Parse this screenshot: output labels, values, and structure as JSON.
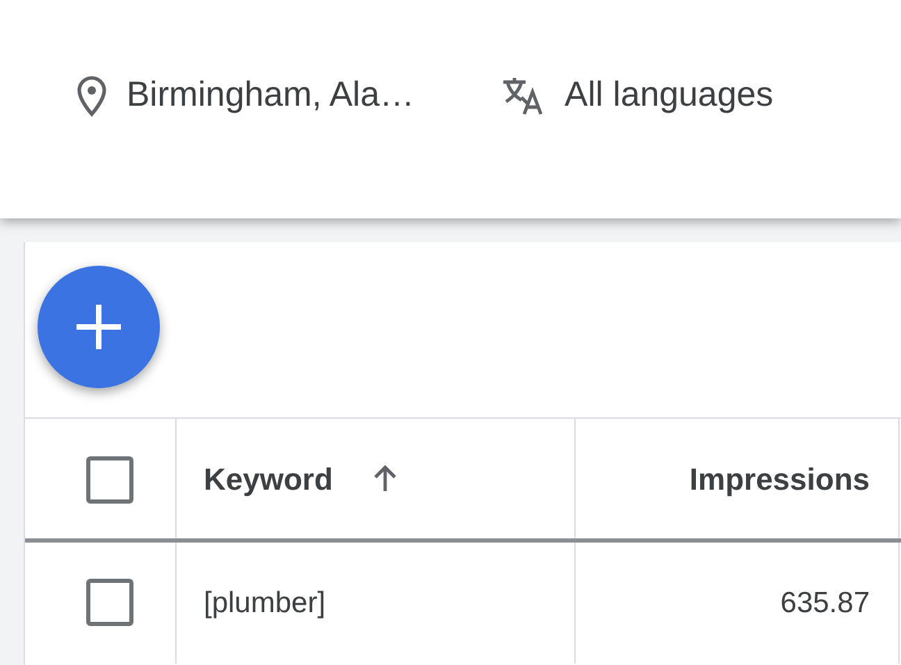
{
  "filters": [
    {
      "kind": "location",
      "label": "Birmingham, Ala…"
    },
    {
      "kind": "language",
      "label": "All languages"
    }
  ],
  "table": {
    "header_checked": false,
    "columns": [
      {
        "label": "Keyword",
        "sorted": true,
        "kind": "text"
      },
      {
        "label": "Impressions",
        "sorted": false,
        "kind": "number"
      }
    ],
    "rows": [
      {
        "checked": false,
        "cells": [
          "[plumber]",
          "635.87"
        ]
      }
    ]
  }
}
